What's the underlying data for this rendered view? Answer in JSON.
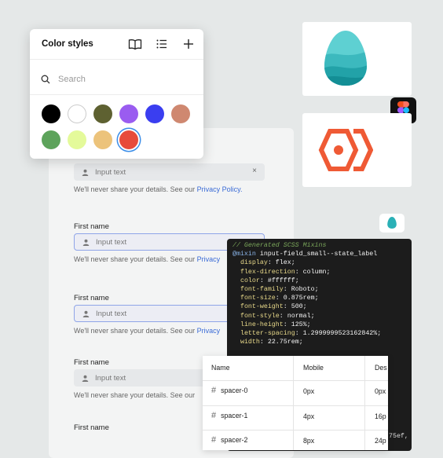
{
  "color_styles": {
    "title": "Color styles",
    "search_placeholder": "Search",
    "swatches": [
      {
        "name": "black",
        "color": "#000000"
      },
      {
        "name": "white",
        "color": "#ffffff"
      },
      {
        "name": "olive",
        "color": "#5e6131"
      },
      {
        "name": "purple",
        "color": "#9a5cf0"
      },
      {
        "name": "blue",
        "color": "#3a3ef0"
      },
      {
        "name": "terracotta",
        "color": "#cf8870"
      },
      {
        "name": "green",
        "color": "#5da35b"
      },
      {
        "name": "light-yellow",
        "color": "#e4fa9a"
      },
      {
        "name": "tan",
        "color": "#ecc37b"
      },
      {
        "name": "red-selected",
        "color": "#e74b3b"
      }
    ]
  },
  "form": {
    "groups": [
      {
        "label": "",
        "placeholder": "Input text",
        "help": "We'll never share your details. See our ",
        "link": "Privacy Policy."
      },
      {
        "label": "First name",
        "placeholder": "Input text",
        "help": "We'll never share your details. See our ",
        "link": "Privacy"
      },
      {
        "label": "First name",
        "placeholder": "Input text",
        "help": "We'll never share your details. See our ",
        "link": "Privacy"
      },
      {
        "label": "First name",
        "placeholder": "Input text",
        "help": "We'll never share your details. See our ",
        "link": ""
      },
      {
        "label": "First name",
        "placeholder": "",
        "help": "",
        "link": ""
      }
    ],
    "clear_symbol": "×"
  },
  "code": {
    "comment": "// Generated SCSS Mixins",
    "mixin_keyword": "@mixin",
    "mixin_name": " input-field_small--state_label",
    "lines": [
      {
        "prop": "display",
        "val": "flex"
      },
      {
        "prop": "flex-direction",
        "val": "column"
      },
      {
        "prop": "color",
        "val": "#ffffff"
      },
      {
        "prop": "font-family",
        "val": "Roboto"
      },
      {
        "prop": "font-size",
        "val": "0.875rem"
      },
      {
        "prop": "font-weight",
        "val": "500"
      },
      {
        "prop": "font-style",
        "val": "normal"
      },
      {
        "prop": "line-height",
        "val": "125%"
      },
      {
        "prop": "letter-spacing",
        "val": "1.2999999523162842%"
      },
      {
        "prop": "width",
        "val": "22.75rem"
      }
    ],
    "tail": "75ef,"
  },
  "table": {
    "headers": [
      "Name",
      "Mobile",
      "Des"
    ],
    "rows": [
      {
        "name": "spacer-0",
        "mobile": "0px",
        "desktop": "0px"
      },
      {
        "name": "spacer-1",
        "mobile": "4px",
        "desktop": "16p"
      },
      {
        "name": "spacer-2",
        "mobile": "8px",
        "desktop": "24p"
      }
    ]
  }
}
